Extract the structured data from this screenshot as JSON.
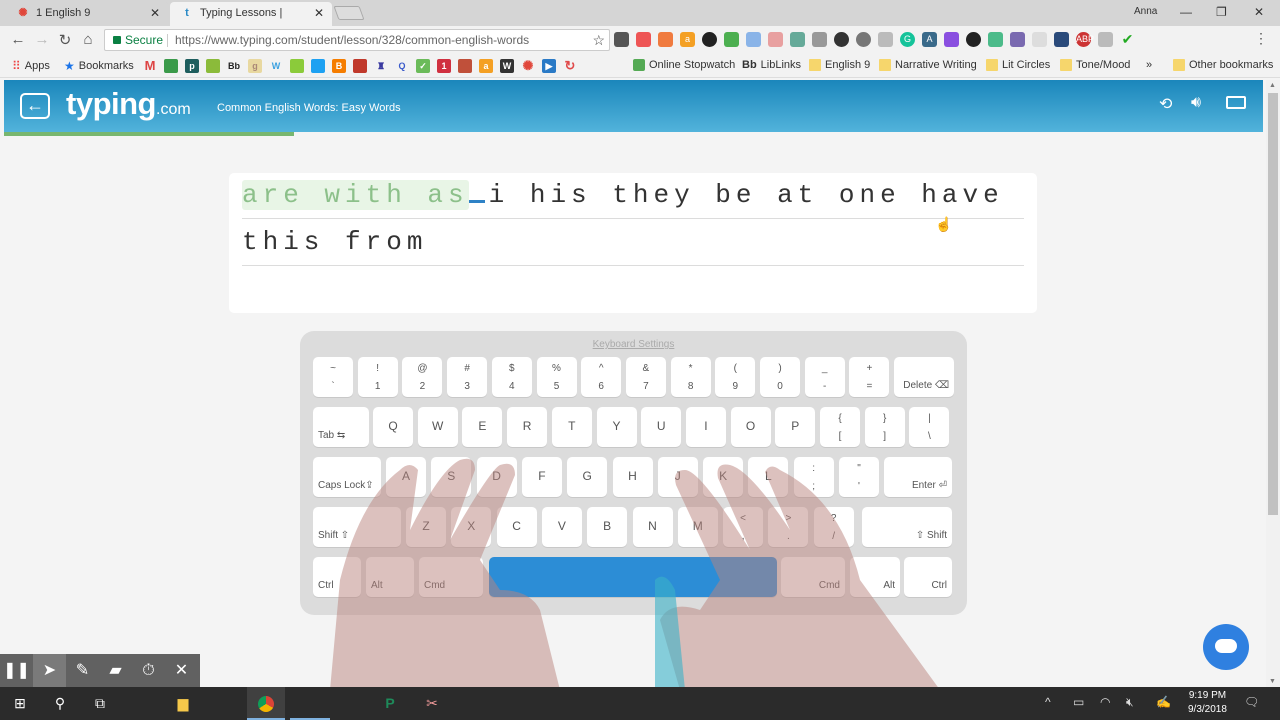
{
  "browser": {
    "tabs": [
      {
        "title": "1 English 9",
        "icon": "canvas-icon",
        "active": false
      },
      {
        "title": "Typing Lessons | Commo",
        "icon": "typing-t-icon",
        "active": true
      }
    ],
    "profile_name": "Anna",
    "address": {
      "secure_label": "Secure",
      "url": "https://www.typing.com/student/lesson/328/common-english-words"
    },
    "bookmarks": {
      "apps_label": "Apps",
      "bookmarks_label": "Bookmarks",
      "items": [
        "Online Stopwatch",
        "LibLinks",
        "English 9",
        "Narrative Writing",
        "Lit Circles",
        "Tone/Mood"
      ],
      "overflow": "»",
      "other_label": "Other bookmarks"
    }
  },
  "app": {
    "logo_main": "typing",
    "logo_suffix": ".com",
    "lesson_title": "Common English Words: Easy Words",
    "progress_percent": 23,
    "typing_text": {
      "typed": "are with as",
      "remaining_line1": "i his they be at one have",
      "line2": "this from"
    },
    "keyboard_settings_label": "Keyboard Settings",
    "keyboard": {
      "row1": [
        [
          "~",
          "`"
        ],
        [
          "!",
          "1"
        ],
        [
          "@",
          "2"
        ],
        [
          "#",
          "3"
        ],
        [
          "$",
          "4"
        ],
        [
          "%",
          "5"
        ],
        [
          "^",
          "6"
        ],
        [
          "&",
          "7"
        ],
        [
          "*",
          "8"
        ],
        [
          "(",
          "9"
        ],
        [
          ")",
          "0"
        ],
        [
          "_",
          "-"
        ],
        [
          "+",
          "="
        ]
      ],
      "delete_label": "Delete ⌫",
      "tab_label": "Tab ⇆",
      "row2": [
        "Q",
        "W",
        "E",
        "R",
        "T",
        "Y",
        "U",
        "I",
        "O",
        "P"
      ],
      "row2_sym": [
        [
          "{",
          "["
        ],
        [
          "}",
          "]"
        ],
        [
          "|",
          "\\"
        ]
      ],
      "caps_label": "Caps Lock⇪",
      "row3": [
        "A",
        "S",
        "D",
        "F",
        "G",
        "H",
        "J",
        "K",
        "L"
      ],
      "row3_sym": [
        [
          ":",
          ";"
        ],
        [
          "\"",
          "'"
        ]
      ],
      "enter_label": "Enter ⏎",
      "shift_left_label": "Shift ⇧",
      "row4": [
        "Z",
        "X",
        "C",
        "V",
        "B",
        "N",
        "M"
      ],
      "row4_sym": [
        [
          "<",
          ","
        ],
        [
          ">",
          "."
        ],
        [
          "?",
          "/"
        ]
      ],
      "shift_right_label": "⇧ Shift",
      "ctrl_label": "Ctrl",
      "alt_label": "Alt",
      "cmd_label": "Cmd"
    }
  },
  "annotation_toolbar": [
    "pause",
    "pointer",
    "pen",
    "highlighter",
    "timer",
    "close"
  ],
  "taskbar": {
    "time": "9:19 PM",
    "date": "9/3/2018"
  }
}
